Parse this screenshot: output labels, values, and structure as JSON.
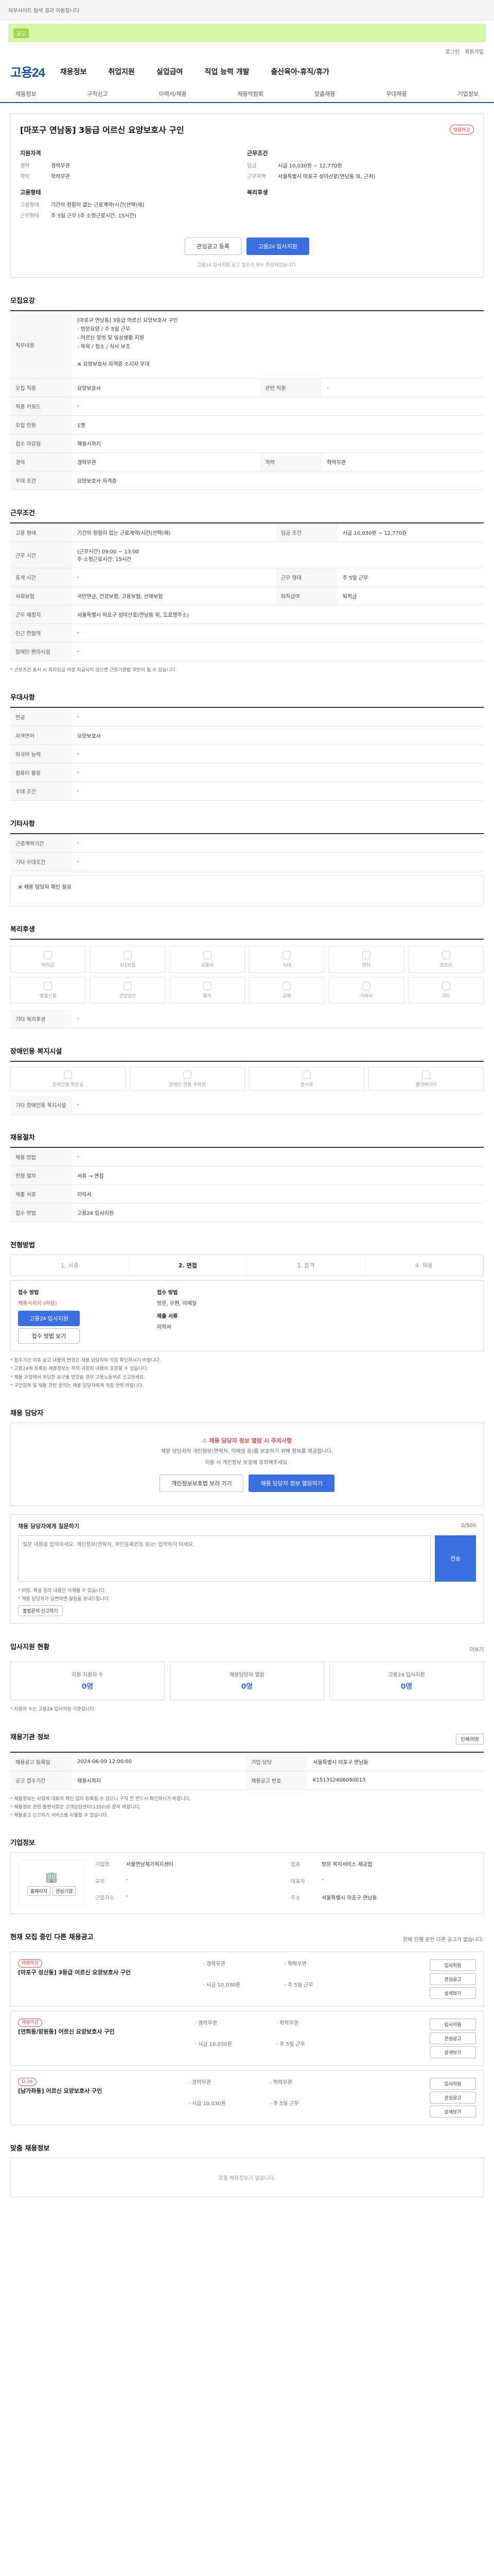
{
  "topbar": {
    "notice": "외부사이트 탐색 결과 이동합니다"
  },
  "greenbar": {
    "chip": "공고",
    "text": ""
  },
  "util": [
    "로그인",
    "회원가입"
  ],
  "header": {
    "logo": "고용24",
    "gnb": [
      "채용정보",
      "취업지원",
      "실업급여",
      "직업 능력 개발",
      "출산육아·휴직/휴가"
    ]
  },
  "subnav": [
    "채용정보",
    "구직신고",
    "이력서/채용",
    "채용박람회",
    "맞춤채용",
    "우대채용",
    "기업정보"
  ],
  "job": {
    "title": "[마포구 연남동] 3등급 어르신 요양보호사 구인",
    "tag": "채용마감",
    "left_title": "지원자격",
    "right_title": "근무조건",
    "left": [
      {
        "k": "경력",
        "v": "경력무관"
      },
      {
        "k": "학력",
        "v": "학력무관"
      }
    ],
    "left2_title": "고용형태",
    "left2": [
      {
        "k": "고용형태",
        "v": "기간의 정함이 없는 근로계약(시간(선택)제)"
      },
      {
        "k": "근무형태",
        "v": "주 5일 근무 (주 소정근로시간: 15시간)"
      }
    ],
    "right": [
      {
        "k": "임금",
        "v": "시급 10,030원 ~ 12,770원"
      },
      {
        "k": "근무지역",
        "v": "서울특별시 마포구 성미산로(연남동 외, 근처)"
      }
    ],
    "right2_title": "복리후생",
    "btn_save": "관심공고 등록",
    "btn_apply": "고용24 입사지원",
    "note": "고용24 입사지원 공고 접수가 모두 마감되었습니다."
  },
  "recruit": {
    "title": "모집요강",
    "content_label": "직무내용",
    "content": "[마포구 연남동] 3등급 어르신 요양보호사 구인\n - 방문요양 / 주 5일 근무\n - 어르신 말벗 및 일상생활 지원\n - 목욕 / 청소 / 식사 보조\n\n※ 요양보호사 자격증 소지자 우대",
    "rows": [
      [
        "모집 직종",
        "요양보호사",
        "관련 직종",
        "-"
      ],
      [
        "직종 키워드",
        "-",
        "",
        ""
      ],
      [
        "모집 인원",
        "1명",
        "",
        ""
      ],
      [
        "접수 마감일",
        "채용시까지",
        "",
        ""
      ],
      [
        "경력",
        "경력무관",
        "학력",
        "학력무관"
      ],
      [
        "우대 조건",
        "요양보호사 자격증",
        "",
        ""
      ]
    ]
  },
  "condition": {
    "title": "근무조건",
    "rows": [
      [
        "고용 형태",
        "기간의 정함이 없는 근로계약(시간(선택)제)",
        "임금 조건",
        "시급 10,030원 ~ 12,770원"
      ],
      [
        "근무 시간",
        "(근무시간) 09:00 ~ 13:00\n주 소정근로시간: 15시간",
        "",
        ""
      ],
      [
        "휴게 시간",
        "-",
        "근무 형태",
        "주 5일 근무"
      ],
      [
        "사회보험",
        "국민연금, 건강보험, 고용보험, 산재보험",
        "퇴직급여",
        "퇴직금"
      ],
      [
        "근무 예정지",
        "서울특별시 마포구 성미산로(연남동 외, 도로명주소)",
        "",
        ""
      ],
      [
        "인근 전철역",
        "-",
        "",
        ""
      ],
      [
        "장애인 편의시설",
        "-",
        "",
        ""
      ]
    ],
    "note": "* 근로조건 표시 시 최저임금 이상 지급되지 않으면 근로기준법 위반이 될 수 있습니다."
  },
  "preference": {
    "title": "우대사항",
    "rows": [
      [
        "전공",
        "-"
      ],
      [
        "자격면허",
        "요양보호사"
      ],
      [
        "외국어 능력",
        "-"
      ],
      [
        "컴퓨터 활용",
        "-"
      ],
      [
        "우대 조건",
        "-"
      ]
    ]
  },
  "etc": {
    "title": "기타사항",
    "rows": [
      [
        "근로계약기간",
        "-"
      ],
      [
        "기타 우대조건",
        "-"
      ]
    ],
    "sub": "※ 채용 담당자 확인 필요"
  },
  "welfare": {
    "title": "복리후생",
    "items": [
      "퇴직금",
      "4대보험",
      "교통비",
      "식대",
      "연차",
      "경조사",
      "명절선물",
      "건강검진",
      "휴가",
      "교육",
      "기숙사",
      "기타"
    ],
    "extra_label": "기타 복리후생",
    "extra": "-"
  },
  "disability": {
    "title": "장애인용 복지시설",
    "items": [
      "장애인용 화장실",
      "장애인 전용 주차장",
      "경사로",
      "엘리베이터"
    ],
    "extra_label": "기타 장애인용 복지시설",
    "extra": "-"
  },
  "company_info": {
    "title": "채용절차",
    "rows": [
      [
        "채용 방법",
        "-",
        "",
        ""
      ],
      [
        "전형 절차",
        "서류 → 면접",
        "",
        ""
      ],
      [
        "제출 서류",
        "이력서",
        "",
        ""
      ],
      [
        "접수 방법",
        "고용24 입사지원",
        "",
        ""
      ]
    ]
  },
  "steps": {
    "title": "전형방법",
    "items": [
      "서류",
      "면접",
      "합격",
      "채용"
    ],
    "active": 1,
    "apply_label": "접수 방법",
    "apply_deadline": "채용시까지 (마감)",
    "btn_apply": "고용24 입사지원",
    "btn_view": "접수 방법 보기",
    "right_label": "접수 방법",
    "right_value": "방문, 우편, 이메일",
    "right_label2": "제출 서류",
    "right_value2": "이력서"
  },
  "notes": [
    "* 접수기간 이후 공고 내용의 변경은 채용 담당자와 직접 확인하시기 바랍니다.",
    "* 고용24에 등록된 채용정보는 허위·과장된 내용이 포함될 수 있습니다.",
    "* 채용 과정에서 부당한 요구를 받았을 경우 고용노동부로 신고하세요.",
    "* 구인업체 및 채용 관련 문의는 채용 담당자에게 직접 연락 바랍니다."
  ],
  "contact": {
    "title": "채용 담당자",
    "alert": "채용 담당자 정보 열람 시 주의사항",
    "text1": "채용 담당자의 개인정보(연락처, 이메일 등)를 보호하기 위해 정보를 제공합니다.",
    "text2": "이용 시 개인정보 보호에 유의해주세요.",
    "btn1": "개인정보보호법 보러 가기",
    "btn2": "채용 담당자 정보 열람하기"
  },
  "inquiry": {
    "title": "채용 담당자에게 질문하기",
    "count": "0/500",
    "placeholder": "질문 내용을 입력하세요. 개인정보(연락처, 주민등록번호 등)는 입력하지 마세요.",
    "send": "전송",
    "notes": [
      "* 비방, 욕설 등의 내용은 삭제될 수 있습니다.",
      "* 채용 담당자가 답변하면 알림을 보내드립니다."
    ],
    "report": "불법문의 신고하기"
  },
  "stats": {
    "title": "입사지원 현황",
    "more": "더보기",
    "items": [
      {
        "lbl": "지원 지원자 수",
        "num": "0명"
      },
      {
        "lbl": "채용담당자 열람",
        "num": "0명"
      },
      {
        "lbl": "고용24 입사지원",
        "num": "0명"
      }
    ],
    "note": "* 지원자 수는 고용24 입사지원 기준입니다."
  },
  "recruit_info": {
    "title": "채용기관 정보",
    "more": "인쇄/저장",
    "rows": [
      [
        "채용공고 등록일",
        "2024-06-09 12:00:00",
        "기업 담당",
        "서울특별시 마포구 연남동"
      ],
      [
        "공고 접수기간",
        "채용시까지",
        "채용공고 번호",
        "K151312406090013"
      ]
    ],
    "notes": [
      "* 채용정보는 사업체 대표의 확인 없이 등록될 수 있으니 구직 전 반드시 확인하시기 바랍니다.",
      "* 채용정보 관련 불편사항은 고객상담센터(1350)로 문의 바랍니다.",
      "* 채용공고 신고하기 서비스를 이용할 수 있습니다."
    ]
  },
  "company": {
    "title": "기업정보",
    "btn_home": "홈페이지",
    "btn_interest": "관심기업",
    "rows": [
      [
        "기업명",
        "서울연남재가복지센터"
      ],
      [
        "업종",
        "방문 복지서비스 제공업"
      ],
      [
        "규모",
        "-"
      ],
      [
        "대표자",
        "-"
      ],
      [
        "근로자수",
        "-"
      ],
      [
        "주소",
        "서울특별시 마포구 연남동"
      ]
    ]
  },
  "other_jobs": {
    "title": "현재 모집 중인 다른 채용공고",
    "note": "현재 진행 중인 다른 공고가 없습니다.",
    "items": [
      {
        "tag": "채용마감",
        "title": "[마포구 성산동] 3등급 어르신 요양보호사 구인",
        "meta": [
          "경력무관",
          "학력무관",
          "시급 10,030원",
          "주 5일 근무"
        ]
      },
      {
        "tag": "채용마감",
        "title": "[연희동/망원동] 어르신 요양보호사 구인",
        "meta": [
          "경력무관",
          "학력무관",
          "시급 10,030원",
          "주 5일 근무"
        ]
      },
      {
        "tag": "D-24",
        "title": "[남가좌동] 어르신 요양보호사 구인",
        "meta": [
          "경력무관",
          "학력무관",
          "시급 10,030원",
          "주 5일 근무"
        ]
      }
    ],
    "side": [
      "입사지원",
      "관심공고",
      "상세보기"
    ]
  },
  "recommend": {
    "title": "맞춤 채용정보",
    "empty": "맞춤 채용정보가 없습니다."
  }
}
